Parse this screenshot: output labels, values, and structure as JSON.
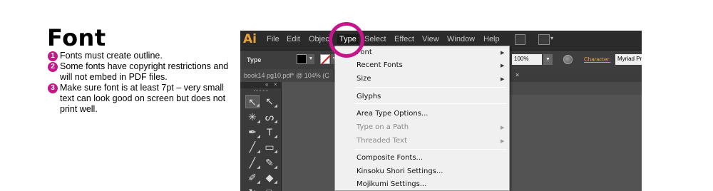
{
  "heading": "Font",
  "notes": [
    {
      "num": "1",
      "text": "Fonts must create outline."
    },
    {
      "num": "2",
      "text": "Some fonts have copyright restrictions and will not embed in PDF files."
    },
    {
      "num": "3",
      "text": "Make sure font is at least 7pt – very small text can look good on screen but does not print well."
    }
  ],
  "app": {
    "logo": "Ai",
    "menus": [
      "File",
      "Edit",
      "Object",
      "Type",
      "Select",
      "Effect",
      "View",
      "Window",
      "Help"
    ],
    "active_menu": "Type",
    "control_label": "Type",
    "zoom_value": "100%",
    "character_label": "Character:",
    "font_field": "Myriad Pro",
    "doc_tab": "book14 pg10.pdf* @ 104% (C",
    "doc_close": "×",
    "panel_collapse": "«",
    "panel_close": "×",
    "accent_color": "#c5178a",
    "logo_color": "#e8a23a"
  },
  "type_menu": {
    "items": [
      {
        "label": "Font",
        "submenu": true,
        "disabled": false
      },
      {
        "label": "Recent Fonts",
        "submenu": true,
        "disabled": false
      },
      {
        "label": "Size",
        "submenu": true,
        "disabled": false
      },
      {
        "label": "Glyphs",
        "submenu": false,
        "disabled": false
      },
      {
        "label": "Area Type Options...",
        "submenu": false,
        "disabled": false
      },
      {
        "label": "Type on a Path",
        "submenu": true,
        "disabled": true
      },
      {
        "label": "Threaded Text",
        "submenu": true,
        "disabled": true
      },
      {
        "label": "Composite Fonts...",
        "submenu": false,
        "disabled": false
      },
      {
        "label": "Kinsoku Shori Settings...",
        "submenu": false,
        "disabled": false
      },
      {
        "label": "Mojikumi Settings...",
        "submenu": false,
        "disabled": false
      }
    ],
    "submenu_arrow": "▶"
  },
  "tools": [
    {
      "name": "selection-tool",
      "glyph": "↖"
    },
    {
      "name": "direct-selection-tool",
      "glyph": "↖"
    },
    {
      "name": "magic-wand-tool",
      "glyph": "✳"
    },
    {
      "name": "lasso-tool",
      "glyph": "ᔕ"
    },
    {
      "name": "pen-tool",
      "glyph": "✒"
    },
    {
      "name": "type-tool",
      "glyph": "T"
    },
    {
      "name": "line-tool",
      "glyph": "╱"
    },
    {
      "name": "rectangle-tool",
      "glyph": "▭"
    },
    {
      "name": "paintbrush-tool",
      "glyph": "╱"
    },
    {
      "name": "pencil-tool",
      "glyph": "✎"
    },
    {
      "name": "blob-brush-tool",
      "glyph": "✐"
    },
    {
      "name": "eraser-tool",
      "glyph": "◆"
    },
    {
      "name": "rotate-tool",
      "glyph": "↻"
    },
    {
      "name": "scale-tool",
      "glyph": "⧉"
    }
  ]
}
